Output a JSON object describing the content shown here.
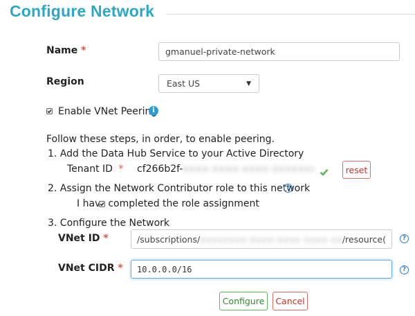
{
  "page": {
    "title": "Configure Network"
  },
  "form": {
    "name": {
      "label": "Name",
      "required_mark": "*",
      "value": "gmanuel-private-network"
    },
    "region": {
      "label": "Region",
      "selected": "East US",
      "caret": "▼"
    },
    "peering": {
      "checkbox_checked": true,
      "label": "Enable VNet Peering",
      "info_icon": "i"
    },
    "steps": {
      "intro": "Follow these steps, in order, to enable peering.",
      "step1": {
        "label": "1. Add the Data Hub Service to your Active Directory",
        "tenant_label": "Tenant ID",
        "required_mark": "*",
        "tenant_value_visible": "cf266b2f-",
        "tenant_value_redacted": "xxxx-xxxx-xxxx-xxxxxxxxxxxx",
        "status_icon": "check-icon",
        "reset_label": "reset"
      },
      "step2": {
        "label": "2. Assign the Network Contributor role to this network",
        "help_icon": "?",
        "checkbox_checked": true,
        "confirm_label_before": "I hav",
        "confirm_label_after": "completed the role assignment"
      },
      "step3": {
        "label": "3. Configure the Network",
        "vnet_id": {
          "label": "VNet ID",
          "required_mark": "*",
          "value_prefix": "/subscriptions/",
          "value_redacted": "xxxxxxxx-xxxx-xxxx-xxxx-xxxxxxxx",
          "value_suffix": "/resource(",
          "help_icon": "?"
        },
        "vnet_cidr": {
          "label": "VNet CIDR",
          "required_mark": "*",
          "value": "10.0.0.0/16",
          "help_icon": "?"
        }
      }
    }
  },
  "actions": {
    "configure_label": "Configure",
    "cancel_label": "Cancel"
  },
  "colors": {
    "title": "#2aa7c9",
    "required": "#d9534f",
    "success": "#5cb85c",
    "danger": "#d9534f",
    "info": "#2a9fd6"
  }
}
